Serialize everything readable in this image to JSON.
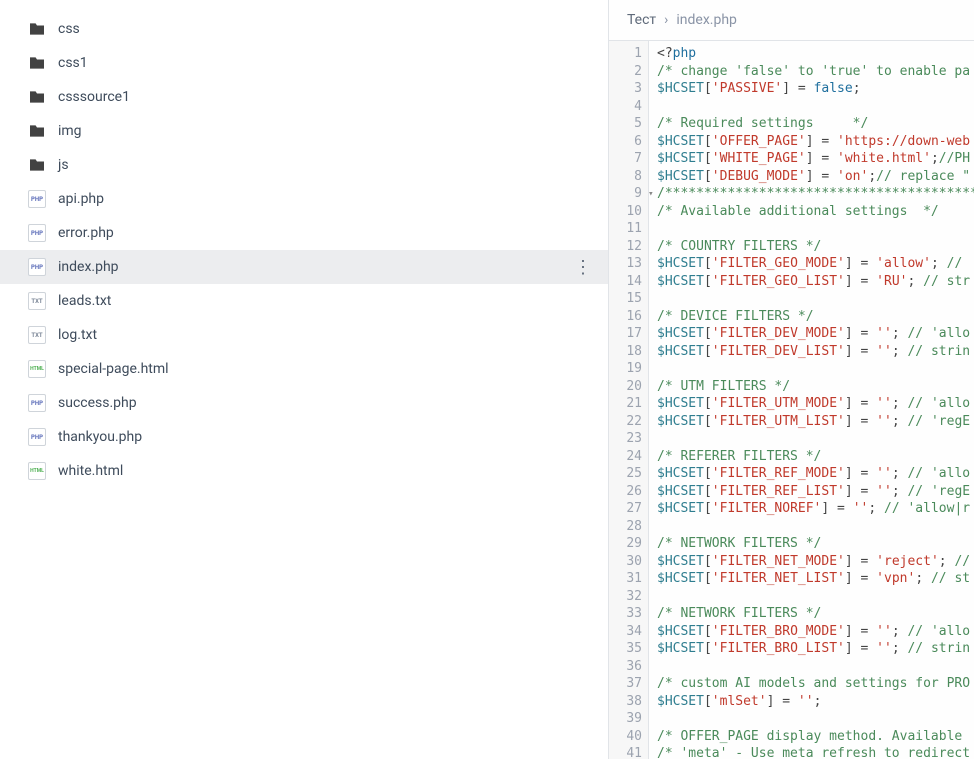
{
  "sidebar": {
    "items": [
      {
        "name": "css",
        "type": "folder"
      },
      {
        "name": "css1",
        "type": "folder"
      },
      {
        "name": "csssource1",
        "type": "folder"
      },
      {
        "name": "img",
        "type": "folder"
      },
      {
        "name": "js",
        "type": "folder"
      },
      {
        "name": "api.php",
        "type": "php"
      },
      {
        "name": "error.php",
        "type": "php"
      },
      {
        "name": "index.php",
        "type": "php",
        "active": true
      },
      {
        "name": "leads.txt",
        "type": "txt"
      },
      {
        "name": "log.txt",
        "type": "txt"
      },
      {
        "name": "special-page.html",
        "type": "html"
      },
      {
        "name": "success.php",
        "type": "php"
      },
      {
        "name": "thankyou.php",
        "type": "php"
      },
      {
        "name": "white.html",
        "type": "html"
      }
    ]
  },
  "breadcrumb": {
    "root": "Тест",
    "separator": "›",
    "current": "index.php"
  },
  "editor": {
    "lines": [
      {
        "n": 1,
        "tokens": [
          [
            "pun",
            "<?"
          ],
          [
            "kw",
            "php"
          ]
        ]
      },
      {
        "n": 2,
        "tokens": [
          [
            "com",
            "/* change 'false' to 'true' to enable pa"
          ]
        ]
      },
      {
        "n": 3,
        "tokens": [
          [
            "var",
            "$HCSET"
          ],
          [
            "pun",
            "["
          ],
          [
            "str",
            "'PASSIVE'"
          ],
          [
            "pun",
            "]"
          ],
          [
            "op",
            " = "
          ],
          [
            "kw",
            "false"
          ],
          [
            "pun",
            ";"
          ]
        ]
      },
      {
        "n": 4,
        "tokens": []
      },
      {
        "n": 5,
        "tokens": [
          [
            "com",
            "/* Required settings     */"
          ]
        ]
      },
      {
        "n": 6,
        "tokens": [
          [
            "var",
            "$HCSET"
          ],
          [
            "pun",
            "["
          ],
          [
            "str",
            "'OFFER_PAGE'"
          ],
          [
            "pun",
            "]"
          ],
          [
            "op",
            " = "
          ],
          [
            "str",
            "'https://down-web"
          ]
        ]
      },
      {
        "n": 7,
        "tokens": [
          [
            "var",
            "$HCSET"
          ],
          [
            "pun",
            "["
          ],
          [
            "str",
            "'WHITE_PAGE'"
          ],
          [
            "pun",
            "]"
          ],
          [
            "op",
            " = "
          ],
          [
            "str",
            "'white.html'"
          ],
          [
            "pun",
            ";"
          ],
          [
            "com",
            "//PH"
          ]
        ]
      },
      {
        "n": 8,
        "tokens": [
          [
            "var",
            "$HCSET"
          ],
          [
            "pun",
            "["
          ],
          [
            "str",
            "'DEBUG_MODE'"
          ],
          [
            "pun",
            "]"
          ],
          [
            "op",
            " = "
          ],
          [
            "str",
            "'on'"
          ],
          [
            "pun",
            ";"
          ],
          [
            "com",
            "// replace \""
          ]
        ]
      },
      {
        "n": 9,
        "fold": true,
        "tokens": [
          [
            "com",
            "/**********************************************"
          ]
        ]
      },
      {
        "n": 10,
        "tokens": [
          [
            "com",
            "/* Available additional settings  */"
          ]
        ]
      },
      {
        "n": 11,
        "tokens": []
      },
      {
        "n": 12,
        "tokens": [
          [
            "com",
            "/* COUNTRY FILTERS */"
          ]
        ]
      },
      {
        "n": 13,
        "tokens": [
          [
            "var",
            "$HCSET"
          ],
          [
            "pun",
            "["
          ],
          [
            "str",
            "'FILTER_GEO_MODE'"
          ],
          [
            "pun",
            "]"
          ],
          [
            "op",
            " = "
          ],
          [
            "str",
            "'allow'"
          ],
          [
            "pun",
            "; "
          ],
          [
            "com",
            "// "
          ]
        ]
      },
      {
        "n": 14,
        "tokens": [
          [
            "var",
            "$HCSET"
          ],
          [
            "pun",
            "["
          ],
          [
            "str",
            "'FILTER_GEO_LIST'"
          ],
          [
            "pun",
            "]"
          ],
          [
            "op",
            " = "
          ],
          [
            "str",
            "'RU'"
          ],
          [
            "pun",
            "; "
          ],
          [
            "com",
            "// str"
          ]
        ]
      },
      {
        "n": 15,
        "tokens": []
      },
      {
        "n": 16,
        "tokens": [
          [
            "com",
            "/* DEVICE FILTERS */"
          ]
        ]
      },
      {
        "n": 17,
        "tokens": [
          [
            "var",
            "$HCSET"
          ],
          [
            "pun",
            "["
          ],
          [
            "str",
            "'FILTER_DEV_MODE'"
          ],
          [
            "pun",
            "]"
          ],
          [
            "op",
            " = "
          ],
          [
            "str",
            "''"
          ],
          [
            "pun",
            "; "
          ],
          [
            "com",
            "// 'allo"
          ]
        ]
      },
      {
        "n": 18,
        "tokens": [
          [
            "var",
            "$HCSET"
          ],
          [
            "pun",
            "["
          ],
          [
            "str",
            "'FILTER_DEV_LIST'"
          ],
          [
            "pun",
            "]"
          ],
          [
            "op",
            " = "
          ],
          [
            "str",
            "''"
          ],
          [
            "pun",
            "; "
          ],
          [
            "com",
            "// strin"
          ]
        ]
      },
      {
        "n": 19,
        "tokens": []
      },
      {
        "n": 20,
        "tokens": [
          [
            "com",
            "/* UTM FILTERS */"
          ]
        ]
      },
      {
        "n": 21,
        "tokens": [
          [
            "var",
            "$HCSET"
          ],
          [
            "pun",
            "["
          ],
          [
            "str",
            "'FILTER_UTM_MODE'"
          ],
          [
            "pun",
            "]"
          ],
          [
            "op",
            " = "
          ],
          [
            "str",
            "''"
          ],
          [
            "pun",
            "; "
          ],
          [
            "com",
            "// 'allo"
          ]
        ]
      },
      {
        "n": 22,
        "tokens": [
          [
            "var",
            "$HCSET"
          ],
          [
            "pun",
            "["
          ],
          [
            "str",
            "'FILTER_UTM_LIST'"
          ],
          [
            "pun",
            "]"
          ],
          [
            "op",
            " = "
          ],
          [
            "str",
            "''"
          ],
          [
            "pun",
            "; "
          ],
          [
            "com",
            "// 'regE"
          ]
        ]
      },
      {
        "n": 23,
        "tokens": []
      },
      {
        "n": 24,
        "tokens": [
          [
            "com",
            "/* REFERER FILTERS */"
          ]
        ]
      },
      {
        "n": 25,
        "tokens": [
          [
            "var",
            "$HCSET"
          ],
          [
            "pun",
            "["
          ],
          [
            "str",
            "'FILTER_REF_MODE'"
          ],
          [
            "pun",
            "]"
          ],
          [
            "op",
            " = "
          ],
          [
            "str",
            "''"
          ],
          [
            "pun",
            "; "
          ],
          [
            "com",
            "// 'allo"
          ]
        ]
      },
      {
        "n": 26,
        "tokens": [
          [
            "var",
            "$HCSET"
          ],
          [
            "pun",
            "["
          ],
          [
            "str",
            "'FILTER_REF_LIST'"
          ],
          [
            "pun",
            "]"
          ],
          [
            "op",
            " = "
          ],
          [
            "str",
            "''"
          ],
          [
            "pun",
            "; "
          ],
          [
            "com",
            "// 'regE"
          ]
        ]
      },
      {
        "n": 27,
        "tokens": [
          [
            "var",
            "$HCSET"
          ],
          [
            "pun",
            "["
          ],
          [
            "str",
            "'FILTER_NOREF'"
          ],
          [
            "pun",
            "]"
          ],
          [
            "op",
            " = "
          ],
          [
            "str",
            "''"
          ],
          [
            "pun",
            "; "
          ],
          [
            "com",
            "// 'allow|r"
          ]
        ]
      },
      {
        "n": 28,
        "tokens": []
      },
      {
        "n": 29,
        "tokens": [
          [
            "com",
            "/* NETWORK FILTERS */"
          ]
        ]
      },
      {
        "n": 30,
        "tokens": [
          [
            "var",
            "$HCSET"
          ],
          [
            "pun",
            "["
          ],
          [
            "str",
            "'FILTER_NET_MODE'"
          ],
          [
            "pun",
            "]"
          ],
          [
            "op",
            " = "
          ],
          [
            "str",
            "'reject'"
          ],
          [
            "pun",
            "; "
          ],
          [
            "com",
            "//"
          ]
        ]
      },
      {
        "n": 31,
        "tokens": [
          [
            "var",
            "$HCSET"
          ],
          [
            "pun",
            "["
          ],
          [
            "str",
            "'FILTER_NET_LIST'"
          ],
          [
            "pun",
            "]"
          ],
          [
            "op",
            " = "
          ],
          [
            "str",
            "'vpn'"
          ],
          [
            "pun",
            "; "
          ],
          [
            "com",
            "// st"
          ]
        ]
      },
      {
        "n": 32,
        "tokens": []
      },
      {
        "n": 33,
        "tokens": [
          [
            "com",
            "/* NETWORK FILTERS */"
          ]
        ]
      },
      {
        "n": 34,
        "tokens": [
          [
            "var",
            "$HCSET"
          ],
          [
            "pun",
            "["
          ],
          [
            "str",
            "'FILTER_BRO_MODE'"
          ],
          [
            "pun",
            "]"
          ],
          [
            "op",
            " = "
          ],
          [
            "str",
            "''"
          ],
          [
            "pun",
            "; "
          ],
          [
            "com",
            "// 'allo"
          ]
        ]
      },
      {
        "n": 35,
        "tokens": [
          [
            "var",
            "$HCSET"
          ],
          [
            "pun",
            "["
          ],
          [
            "str",
            "'FILTER_BRO_LIST'"
          ],
          [
            "pun",
            "]"
          ],
          [
            "op",
            " = "
          ],
          [
            "str",
            "''"
          ],
          [
            "pun",
            "; "
          ],
          [
            "com",
            "// strin"
          ]
        ]
      },
      {
        "n": 36,
        "tokens": []
      },
      {
        "n": 37,
        "tokens": [
          [
            "com",
            "/* custom AI models and settings for PRO"
          ]
        ]
      },
      {
        "n": 38,
        "tokens": [
          [
            "var",
            "$HCSET"
          ],
          [
            "pun",
            "["
          ],
          [
            "str",
            "'mlSet'"
          ],
          [
            "pun",
            "]"
          ],
          [
            "op",
            " = "
          ],
          [
            "str",
            "''"
          ],
          [
            "pun",
            ";"
          ]
        ]
      },
      {
        "n": 39,
        "tokens": []
      },
      {
        "n": 40,
        "tokens": [
          [
            "com",
            "/* OFFER_PAGE display method. Available "
          ]
        ]
      },
      {
        "n": 41,
        "tokens": [
          [
            "com",
            "/* 'meta' - Use meta refresh to redirect"
          ]
        ]
      }
    ]
  }
}
